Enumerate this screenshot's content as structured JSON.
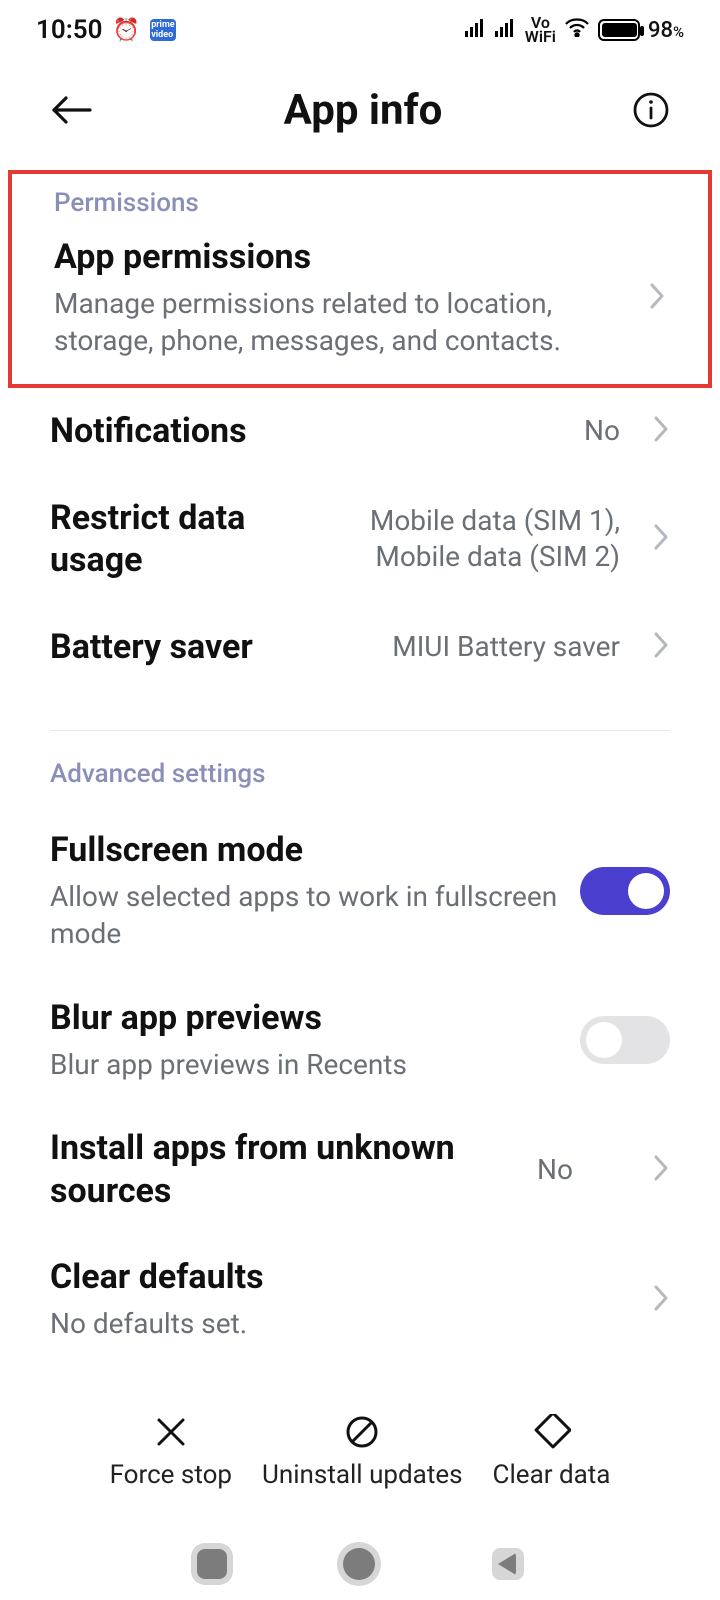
{
  "status": {
    "time": "10:50",
    "battery_pct": "98",
    "battery_suffix": "%",
    "indicators": {
      "alarm": true,
      "prime_video": true,
      "signal1": true,
      "signal2": true,
      "vo_wifi": "Vo\nWiFi",
      "wifi": true
    }
  },
  "header": {
    "title": "App info"
  },
  "sections": {
    "permissions": {
      "label": "Permissions",
      "app_permissions": {
        "title": "App permissions",
        "sub": "Manage permissions related to location, storage, phone, messages, and contacts."
      }
    },
    "notifications": {
      "title": "Notifications",
      "value": "No"
    },
    "restrict_data": {
      "title": "Restrict data usage",
      "value": "Mobile data (SIM 1), Mobile data (SIM 2)"
    },
    "battery_saver": {
      "title": "Battery saver",
      "value": "MIUI Battery saver"
    },
    "advanced": {
      "label": "Advanced settings",
      "fullscreen": {
        "title": "Fullscreen mode",
        "sub": "Allow selected apps to work in fullscreen mode",
        "on": true
      },
      "blur": {
        "title": "Blur app previews",
        "sub": "Blur app previews in Recents",
        "on": false
      },
      "unknown_sources": {
        "title": "Install apps from unknown sources",
        "value": "No"
      },
      "clear_defaults": {
        "title": "Clear defaults",
        "sub": "No defaults set."
      }
    }
  },
  "bottom_actions": {
    "force_stop": "Force stop",
    "uninstall_updates": "Uninstall updates",
    "clear_data": "Clear data"
  }
}
